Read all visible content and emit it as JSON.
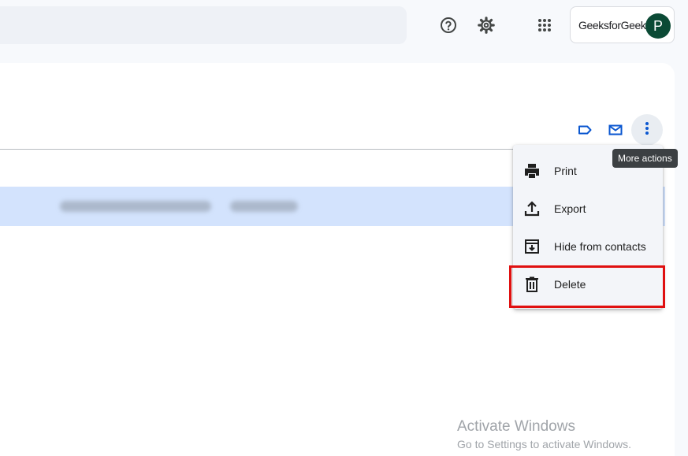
{
  "header": {
    "help_icon": "help-icon",
    "settings_icon": "gear-icon",
    "apps_icon": "apps-grid-icon",
    "account": {
      "brand": "GeeksforGeeks",
      "avatar_letter": "P",
      "avatar_color": "#0b4a35"
    }
  },
  "toolbar": {
    "label_icon": "label-icon",
    "email_icon": "email-icon",
    "more_icon": "more-vert-icon"
  },
  "tooltip": {
    "text": "More actions"
  },
  "menu": {
    "items": [
      {
        "label": "Print",
        "icon": "print-icon"
      },
      {
        "label": "Export",
        "icon": "export-icon"
      },
      {
        "label": "Hide from contacts",
        "icon": "archive-icon"
      },
      {
        "label": "Delete",
        "icon": "trash-icon"
      }
    ]
  },
  "colors": {
    "accent": "#0b57d0",
    "highlight_row": "#d3e3fd",
    "delete_outline": "#e01010"
  },
  "watermark": {
    "title": "Activate Windows",
    "subtitle": "Go to Settings to activate Windows."
  }
}
